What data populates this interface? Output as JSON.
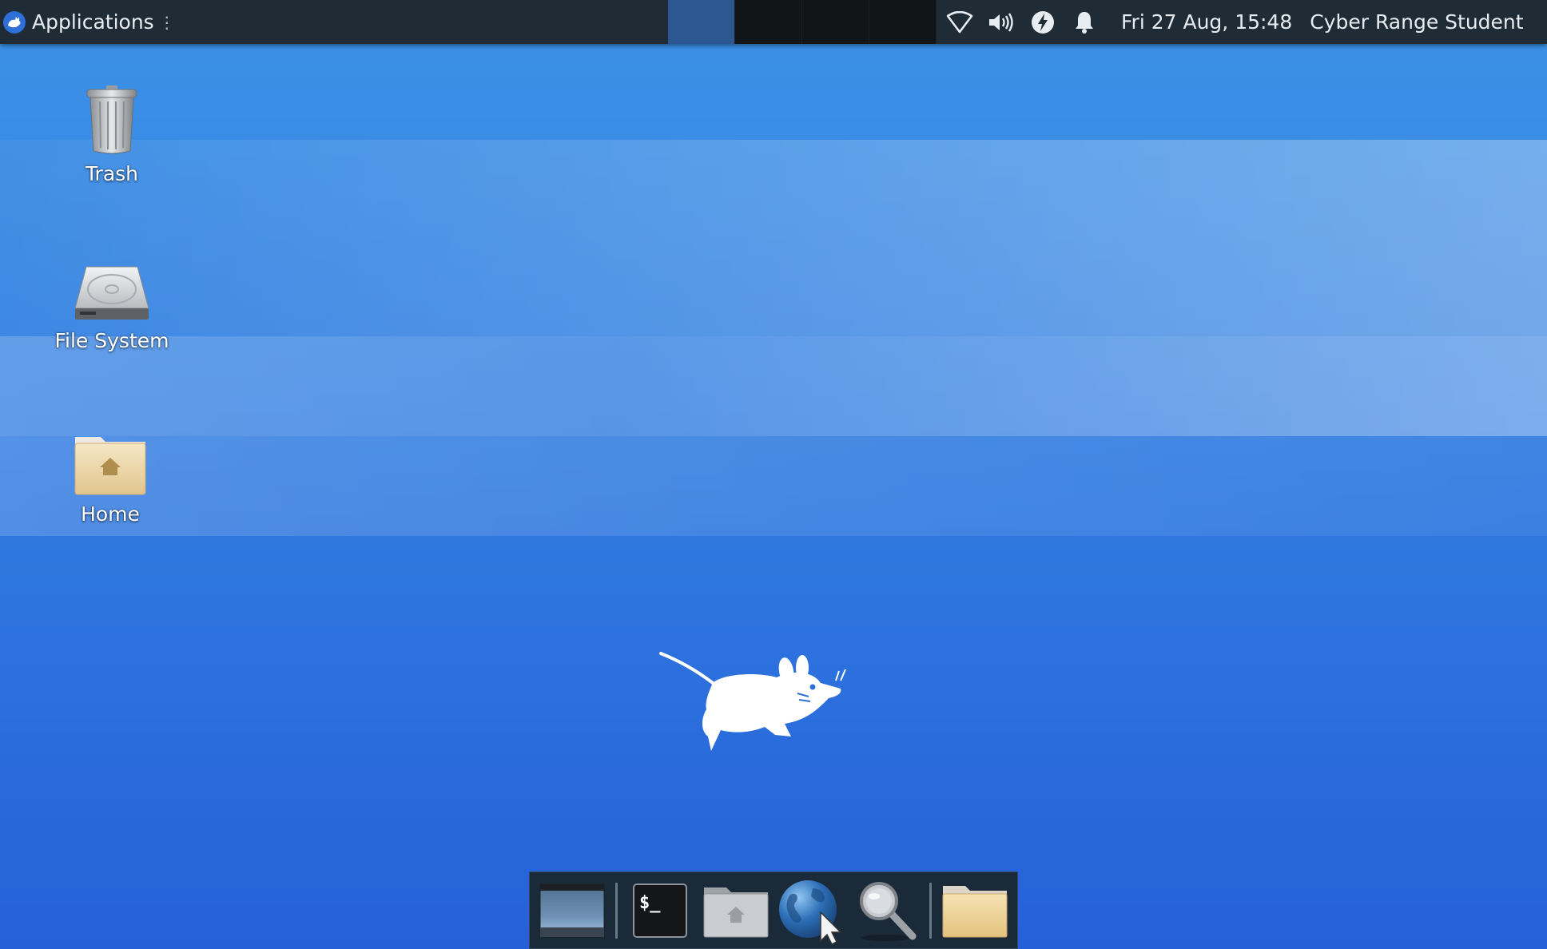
{
  "panel": {
    "applications_label": "Applications",
    "clock": "Fri 27 Aug, 15:48",
    "user": "Cyber Range Student",
    "tray_icons": [
      "wifi-icon",
      "volume-icon",
      "power-icon",
      "bell-icon"
    ],
    "workspaces": 4,
    "active_workspace": 1
  },
  "desktop": {
    "icons": [
      {
        "label": "Trash",
        "icon": "trash-icon"
      },
      {
        "label": "File System",
        "icon": "harddrive-icon"
      },
      {
        "label": "Home",
        "icon": "home-folder-icon"
      }
    ]
  },
  "dock": {
    "items": [
      "show-desktop-icon",
      "terminal-icon",
      "file-manager-icon",
      "web-browser-icon",
      "app-finder-icon",
      "folder-icon"
    ]
  },
  "colors": {
    "panel_bg": "#1f2b35",
    "active_workspace": "#2d5790",
    "desktop_blue": "#3079e0"
  }
}
